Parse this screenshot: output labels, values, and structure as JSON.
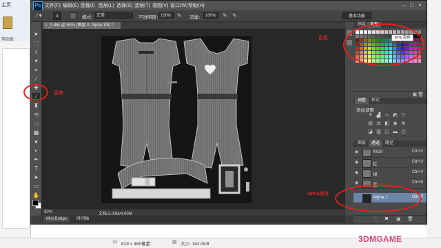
{
  "background_window": {
    "ribbon_tab": "主页",
    "clipboard_label": "剪贴板"
  },
  "ps": {
    "logo": "Ps",
    "menu": [
      "文件(F)",
      "编辑(E)",
      "图像(I)",
      "图层(L)",
      "选择(S)",
      "滤镜(T)",
      "视图(V)",
      "窗口(W)",
      "帮助(H)"
    ],
    "options": {
      "brush_size": "4",
      "mode_label": "模式：",
      "mode_value": "正常",
      "opacity_label": "不透明度：",
      "opacity_value": "100%",
      "flow_label": "流量：",
      "flow_value": "100%"
    },
    "workspace": "基本功能",
    "document_tab": "L_0.dds @ 50% (图层 0, Alpha 1/8) *",
    "zoom": "50%",
    "doc_size": "文档:3.00M/4.00M",
    "bottom_tabs": [
      "Mini Bridge",
      "时间轴"
    ]
  },
  "panels": {
    "swatch_tabs": [
      "颜色",
      "色板"
    ],
    "swatch_tooltip": "30% 灰色",
    "adjust_tabs": [
      "调整",
      "样式"
    ],
    "adjust_title": "添加调整",
    "channel_tabs": [
      "图层",
      "通道",
      "路径"
    ],
    "channels": [
      {
        "name": "RGB",
        "shortcut": "Ctrl+2"
      },
      {
        "name": "红",
        "shortcut": "Ctrl+3"
      },
      {
        "name": "绿",
        "shortcut": "Ctrl+4"
      },
      {
        "name": "蓝",
        "shortcut": "Ctrl+5"
      },
      {
        "name": "Alpha 1",
        "shortcut": "Ctrl+6"
      }
    ]
  },
  "annotations": {
    "brush": "画笔",
    "swatches": "色板",
    "alpha": "alpha通道"
  },
  "win_status": {
    "dimensions": "819 × 460像素",
    "size": "大小: 162.0KB"
  },
  "watermark": "3DMGAME",
  "colors": {
    "annotation_red": "#e8201a",
    "ps_blue": "#31a8ff",
    "selected_channel": "#6e85a8"
  }
}
